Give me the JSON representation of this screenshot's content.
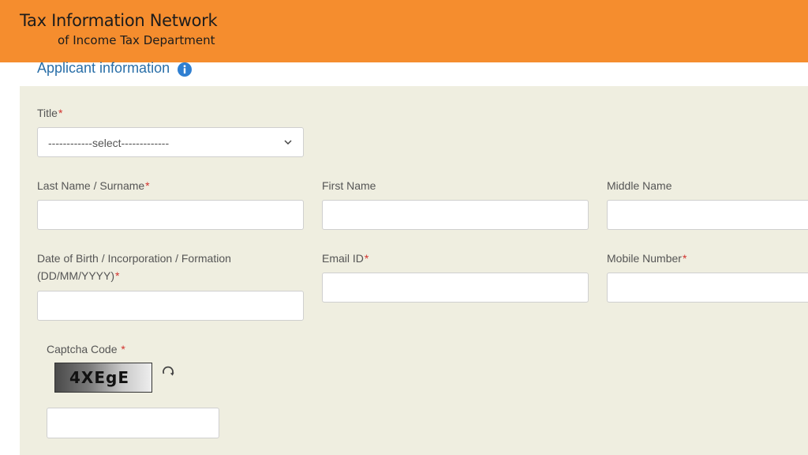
{
  "header": {
    "logo_line1": "Tax Information Network",
    "logo_line2": "of Income Tax Department",
    "background": "#f58d2e"
  },
  "section": {
    "title": "Applicant information",
    "info_icon": "info-circle-icon"
  },
  "form": {
    "required_marker": "*",
    "title": {
      "label": "Title",
      "selected": "------------select-------------"
    },
    "last_name": {
      "label": "Last Name / Surname",
      "value": ""
    },
    "first_name": {
      "label": "First Name",
      "value": ""
    },
    "middle_name": {
      "label": "Middle Name",
      "value": ""
    },
    "dob": {
      "label_line1": "Date of Birth / Incorporation / Formation",
      "label_line2": "(DD/MM/YYYY)",
      "value": ""
    },
    "email": {
      "label": "Email ID",
      "value": ""
    },
    "mobile": {
      "label": "Mobile Number",
      "value": ""
    },
    "captcha": {
      "label": "Captcha Code",
      "code": "4XEgE",
      "value": "",
      "refresh_icon": "refresh-icon"
    }
  },
  "colors": {
    "panel": "#efeee0",
    "accent_text": "#2a6fa8",
    "required": "#d2322d"
  }
}
